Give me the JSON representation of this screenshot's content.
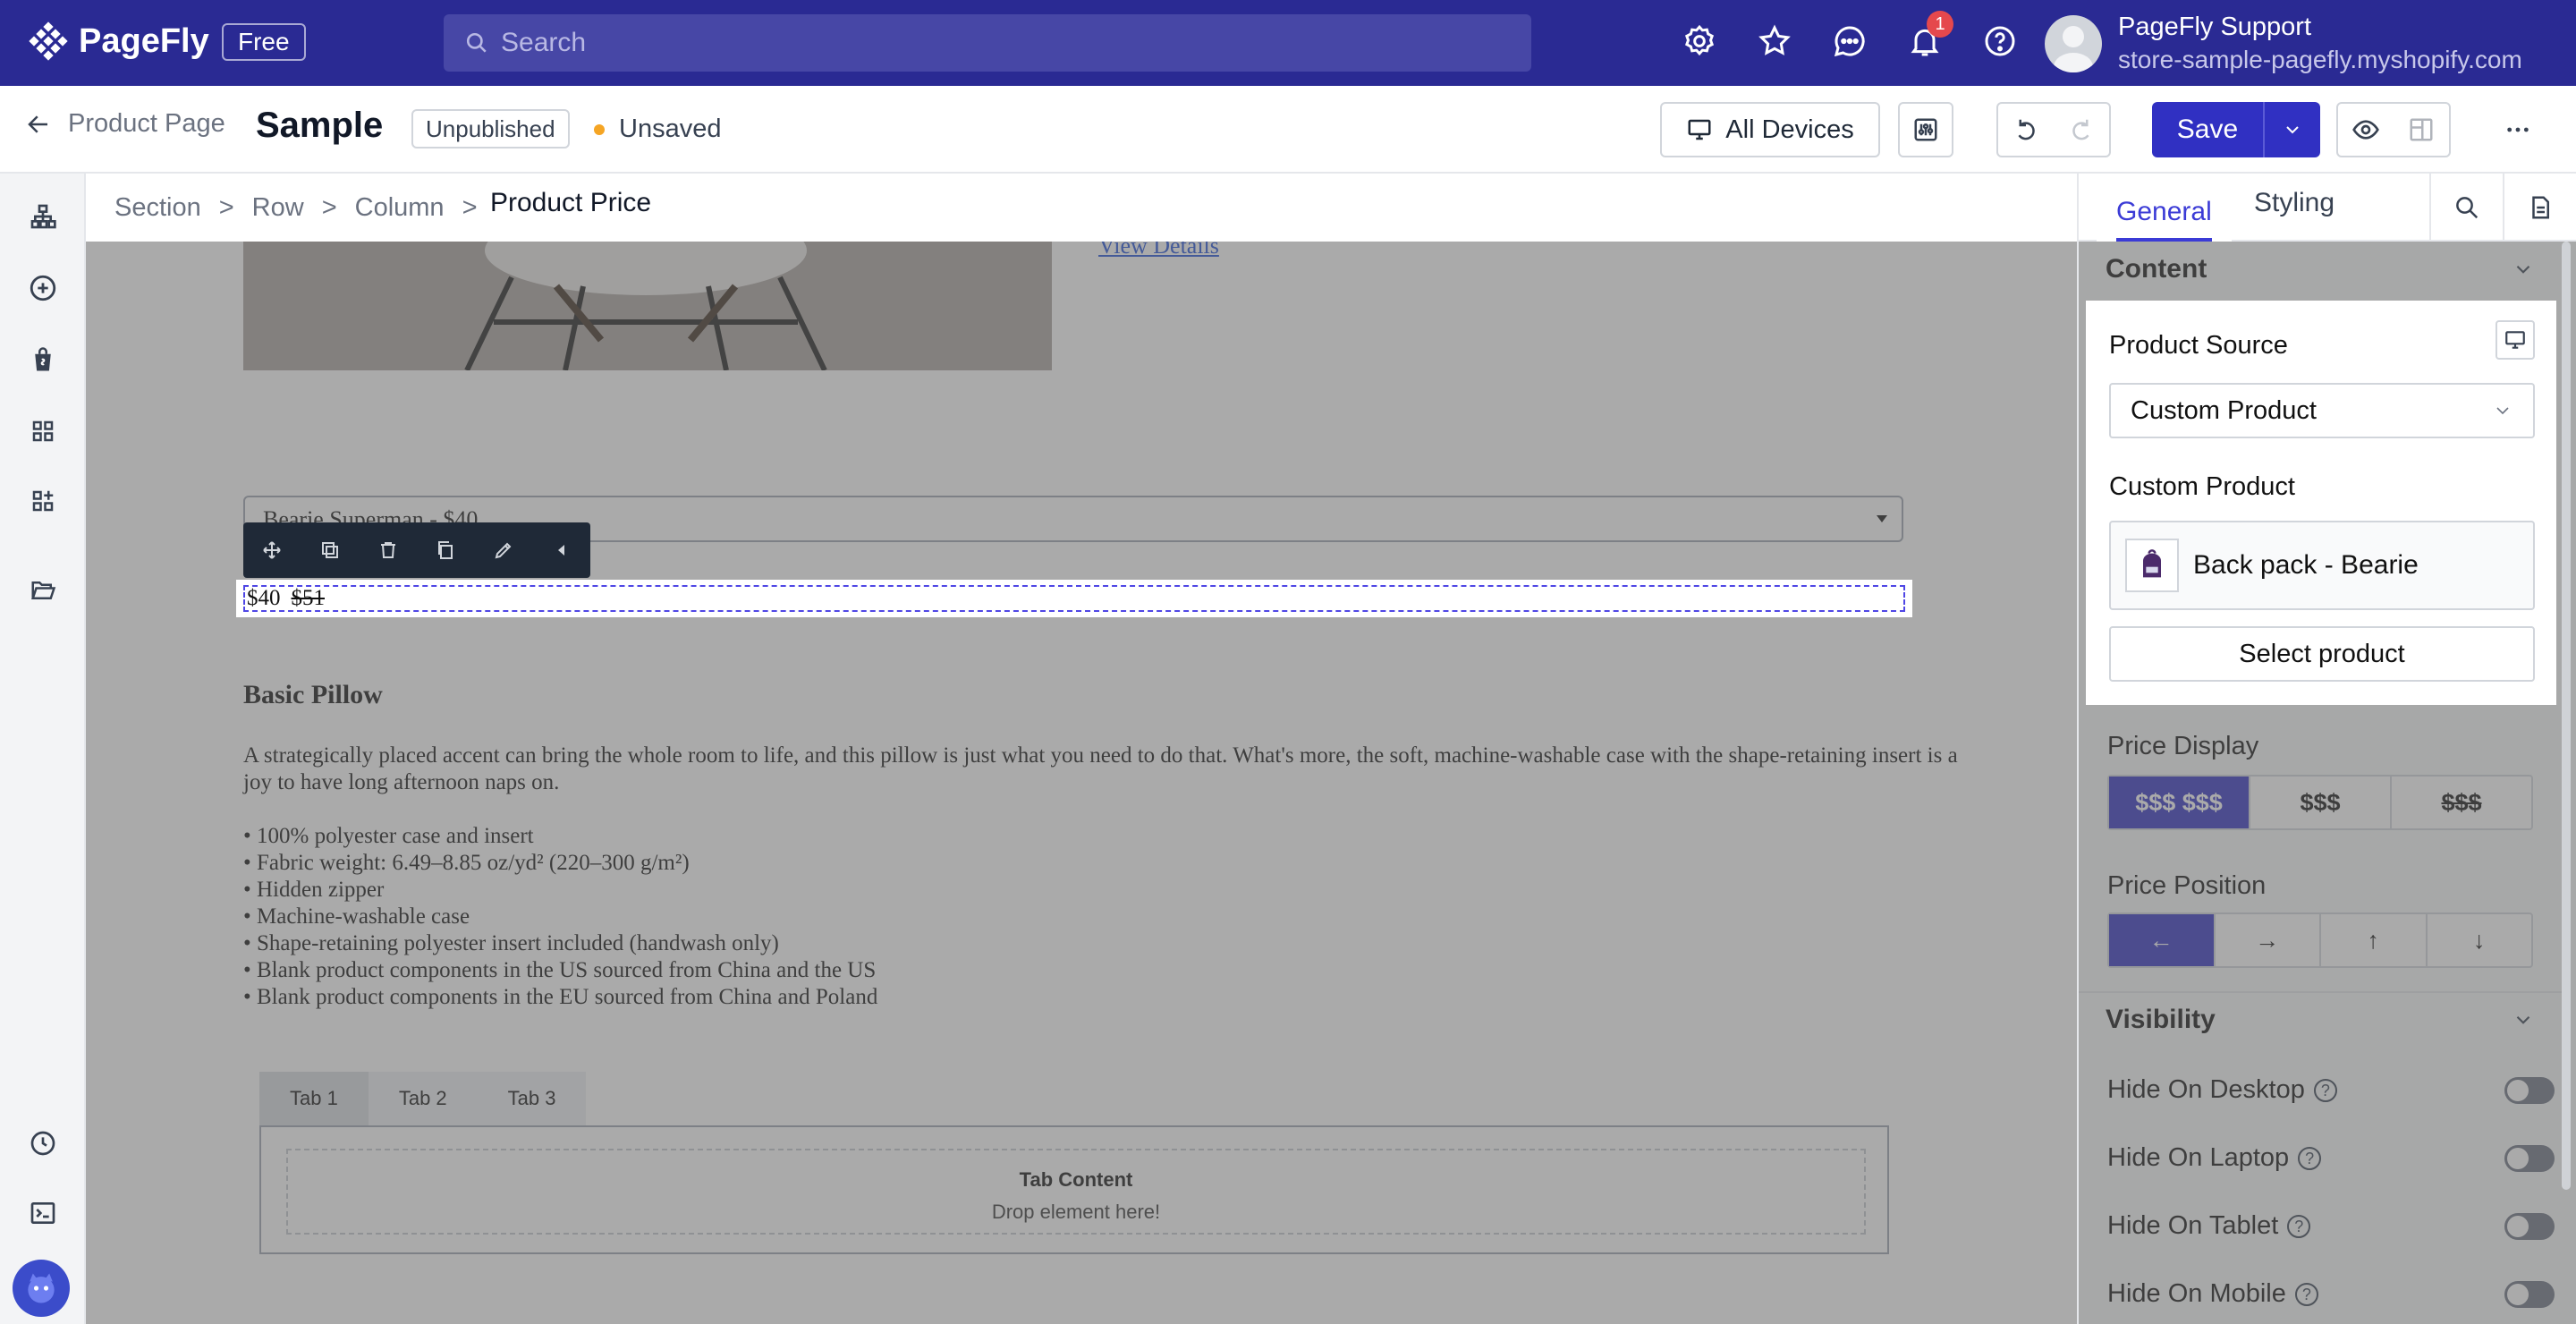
{
  "topbar": {
    "brand": "PageFly",
    "plan_badge": "Free",
    "search_placeholder": "Search",
    "notification_count": "1",
    "account_name": "PageFly Support",
    "account_store": "store-sample-pagefly.myshopify.com",
    "icons": [
      "settings-icon",
      "star-icon",
      "chat-icon",
      "bell-icon",
      "help-icon"
    ]
  },
  "subbar": {
    "back_label": "Product Page",
    "page_title": "Sample",
    "publish_status": "Unpublished",
    "save_status": "Unsaved",
    "devices_label": "All Devices",
    "save_label": "Save"
  },
  "breadcrumb": {
    "items": [
      "Section",
      "Row",
      "Column"
    ],
    "separator": ">",
    "current": "Product Price"
  },
  "canvas": {
    "view_details": "View Details",
    "variant_select": "Bearie Superman - $40",
    "price": "$40",
    "compare_price": "$51",
    "product_title": "Basic Pillow",
    "description": "A strategically placed accent can bring the whole room to life, and this pillow is just what you need to do that. What's more, the soft, machine-washable case with the shape-retaining insert is a joy to have long afternoon naps on.",
    "bullets": [
      "• 100% polyester case and insert",
      "• Fabric weight: 6.49–8.85 oz/yd² (220–300 g/m²)",
      "• Hidden zipper",
      "• Machine-washable case",
      "• Shape-retaining polyester insert included (handwash only)",
      "• Blank product components in the US sourced from China and the US",
      "• Blank product components in the EU sourced from China and Poland"
    ],
    "tabs": [
      "Tab 1",
      "Tab 2",
      "Tab 3"
    ],
    "tab_content_title": "Tab Content",
    "tab_content_hint": "Drop element here!"
  },
  "panel": {
    "tabs": [
      "General",
      "Styling"
    ],
    "content_header": "Content",
    "product_source_label": "Product Source",
    "product_source_value": "Custom Product",
    "custom_product_label": "Custom Product",
    "selected_product": "Back pack - Bearie",
    "select_product_btn": "Select product",
    "price_display_label": "Price Display",
    "price_display_options": [
      "$$$ $$$",
      "$$$",
      "$$$"
    ],
    "price_position_label": "Price Position",
    "price_position_options": [
      "←",
      "→",
      "↑",
      "↓"
    ],
    "visibility_header": "Visibility",
    "visibility": [
      {
        "label": "Hide On Desktop",
        "on": false
      },
      {
        "label": "Hide On Laptop",
        "on": false
      },
      {
        "label": "Hide On Tablet",
        "on": false
      },
      {
        "label": "Hide On Mobile",
        "on": false
      }
    ]
  },
  "colors": {
    "topbar_bg": "#2a2a93",
    "accent": "#3030c2",
    "highlight_border": "#4f46e5"
  }
}
